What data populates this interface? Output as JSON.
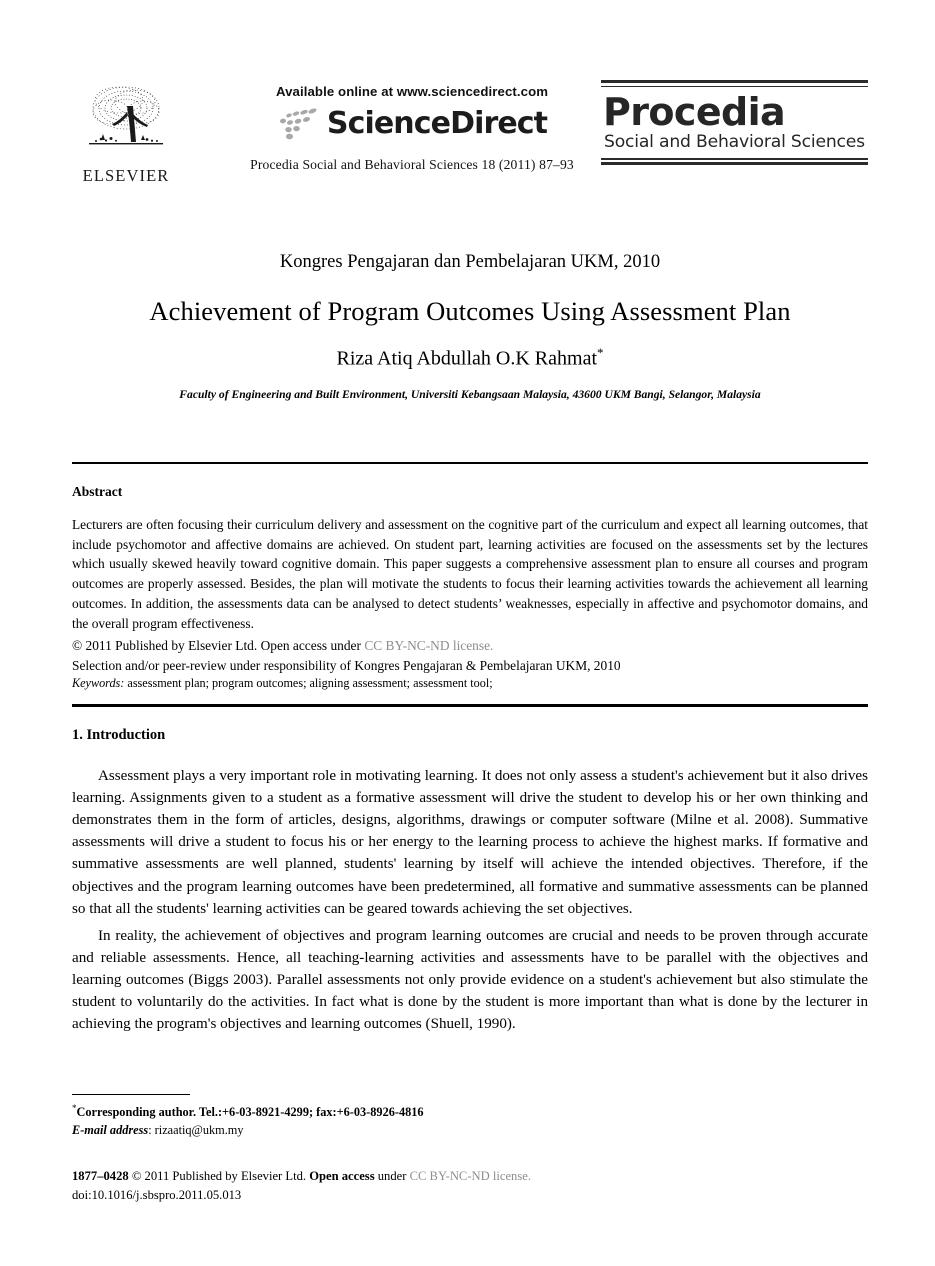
{
  "masthead": {
    "elsevier": {
      "wordmark": "ELSEVIER",
      "logo_icon": "elsevier-tree-icon"
    },
    "sciencedirect": {
      "available_line": "Available online at www.sciencedirect.com",
      "wordmark": "ScienceDirect",
      "logo_icon": "sciencedirect-dots-icon",
      "citation": "Procedia Social and Behavioral Sciences 18 (2011) 87–93"
    },
    "procedia": {
      "title": "Procedia",
      "subtitle": "Social and Behavioral Sciences"
    }
  },
  "title_block": {
    "conference": "Kongres Pengajaran dan Pembelajaran UKM, 2010",
    "paper_title": "Achievement of Program Outcomes Using Assessment Plan",
    "authors": "Riza Atiq Abdullah O.K Rahmat",
    "author_footnote_marker": "*",
    "affiliation": "Faculty of Engineering and Built Environment, Universiti Kebangsaan Malaysia, 43600 UKM Bangi, Selangor, Malaysia"
  },
  "abstract": {
    "heading": "Abstract",
    "body": "Lecturers are often focusing their curriculum delivery and assessment on the cognitive part of the curriculum and expect all learning outcomes, that include psychomotor and affective domains are achieved. On student part, learning activities are focused on the assessments set by the lectures which usually skewed heavily toward cognitive domain. This paper suggests a comprehensive assessment plan to ensure all courses and program outcomes are properly assessed. Besides, the plan will motivate the students to focus their learning activities towards the achievement all learning outcomes. In addition, the assessments data can be analysed to detect students’ weaknesses, especially in affective and psychomotor domains, and the overall program effectiveness.",
    "copyright_prefix": "© 2011 Published by Elsevier Ltd. Open access under ",
    "copyright_license": "CC BY-NC-ND license.",
    "peer_review": "Selection and/or peer-review under responsibility of Kongres Pengajaran & Pembelajaran UKM, 2010",
    "keywords_label": "Keywords:",
    "keywords_value": " assessment plan; program outcomes; aligning assessment; assessment tool;"
  },
  "introduction": {
    "heading": "1. Introduction",
    "paragraph_1": "Assessment plays a very important role in motivating learning. It does not only assess a student's achievement but it also drives learning. Assignments given to a student as a formative assessment will drive the student to develop his or her own thinking and demonstrates them in the form of articles, designs, algorithms, drawings or computer software (Milne et al. 2008). Summative assessments will drive a student to focus his or her energy to the learning process to achieve the highest marks. If formative and summative assessments are well planned, students' learning by itself will achieve the intended objectives. Therefore, if the objectives and the program learning outcomes have been predetermined, all formative and summative assessments can be planned so that all the students' learning activities can be geared towards achieving the set objectives.",
    "paragraph_2": "In reality, the achievement of objectives and program learning outcomes are crucial and needs to be proven through accurate and reliable assessments. Hence, all teaching-learning activities and assessments have to be parallel with the objectives and learning outcomes (Biggs 2003). Parallel assessments not only provide evidence on a student's achievement but also stimulate the student to voluntarily do the activities. In fact what is done by the student is more important than what is done by the lecturer in achieving the program's objectives and learning outcomes (Shuell, 1990)."
  },
  "footnote": {
    "marker": "*",
    "corresponding": "Corresponding author. Tel.:+6-03-8921-4299; fax:+6-03-8926-4816",
    "email_label": "E-mail address",
    "email_value": ": rizaatiq@ukm.my"
  },
  "colophon": {
    "issn_line_prefix": "1877–0428 ",
    "issn_line_copyright": "© 2011 Published by Elsevier Ltd. ",
    "issn_open_access": "Open access",
    "issn_under": " under ",
    "issn_license": "CC BY-NC-ND license.",
    "doi": "doi:10.1016/j.sbspro.2011.05.013"
  },
  "colors": {
    "text": "#000000",
    "license_gray": "#8d8d8d",
    "logo_gray": "#9b9b9b",
    "rule": "#000000"
  }
}
